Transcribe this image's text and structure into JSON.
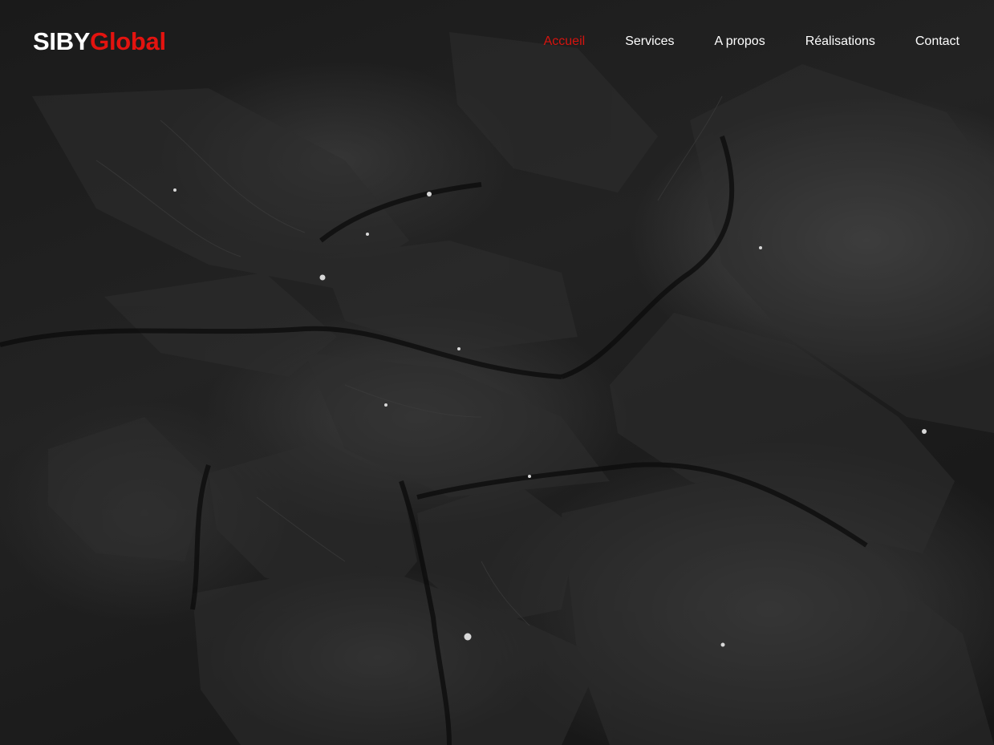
{
  "brand": {
    "part1": "SIBY",
    "part2": "Global"
  },
  "nav": {
    "items": [
      {
        "label": "Accueil",
        "active": true
      },
      {
        "label": "Services",
        "active": false
      },
      {
        "label": "A propos",
        "active": false
      },
      {
        "label": "Réalisations",
        "active": false
      },
      {
        "label": "Contact",
        "active": false
      }
    ]
  },
  "colors": {
    "accent": "#d6140f",
    "brand_red": "#e3130f",
    "text": "#ffffff",
    "background": "#141414"
  },
  "hero": {
    "background": "dark-cracked-leaves-photo"
  }
}
